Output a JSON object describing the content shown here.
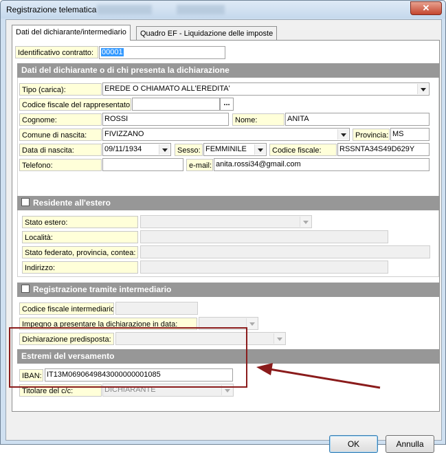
{
  "window": {
    "title": "Registrazione telematica",
    "close_glyph": "✕"
  },
  "tabs": [
    {
      "label": "Dati del dichiarante/intermediario"
    },
    {
      "label": "Quadro EF - Liquidazione delle imposte"
    }
  ],
  "contract": {
    "label": "Identificativo contratto:",
    "value": "00001"
  },
  "section_dichiarante": {
    "header": "Dati del dichiarante o di chi presenta la dichiarazione",
    "tipo_label": "Tipo (carica):",
    "tipo_value": "EREDE O CHIAMATO ALL'EREDITA'",
    "cf_rappr_label": "Codice fiscale del rappresentato:",
    "cf_rappr_value": "",
    "browse_label": "...",
    "cognome_label": "Cognome:",
    "cognome_value": "ROSSI",
    "nome_label": "Nome:",
    "nome_value": "ANITA",
    "comune_label": "Comune di nascita:",
    "comune_value": "FIVIZZANO",
    "provincia_label": "Provincia:",
    "provincia_value": "MS",
    "data_label": "Data di nascita:",
    "data_value": "09/11/1934",
    "sesso_label": "Sesso:",
    "sesso_value": "FEMMINILE",
    "cf_label": "Codice fiscale:",
    "cf_value": "RSSNTA34S49D629Y",
    "telefono_label": "Telefono:",
    "telefono_value": "",
    "email_label": "e-mail:",
    "email_value": "anita.rossi34@gmail.com"
  },
  "section_estero": {
    "header": "Residente all'estero",
    "checked": false,
    "stato_label": "Stato estero:",
    "localita_label": "Località:",
    "federato_label": "Stato federato, provincia, contea:",
    "indirizzo_label": "Indirizzo:"
  },
  "section_intermediario": {
    "header": "Registrazione tramite intermediario",
    "checked": false,
    "cf_label": "Codice fiscale intermediario:",
    "impegno_label": "Impegno a presentare la dichiarazione in data:",
    "predisposta_label": "Dichiarazione predisposta:"
  },
  "section_versamento": {
    "header": "Estremi del versamento",
    "iban_label": "IBAN:",
    "iban_value": "IT13M0690649843000000001085",
    "titolare_label": "Titolare del c/c:",
    "titolare_value": "DICHIARANTE"
  },
  "buttons": {
    "ok": "OK",
    "annulla": "Annulla"
  },
  "colors": {
    "highlight_box": "#8a1b1b",
    "arrow": "#8a1b1b",
    "section_header": "#979797",
    "label_bg": "#ffffd9"
  }
}
